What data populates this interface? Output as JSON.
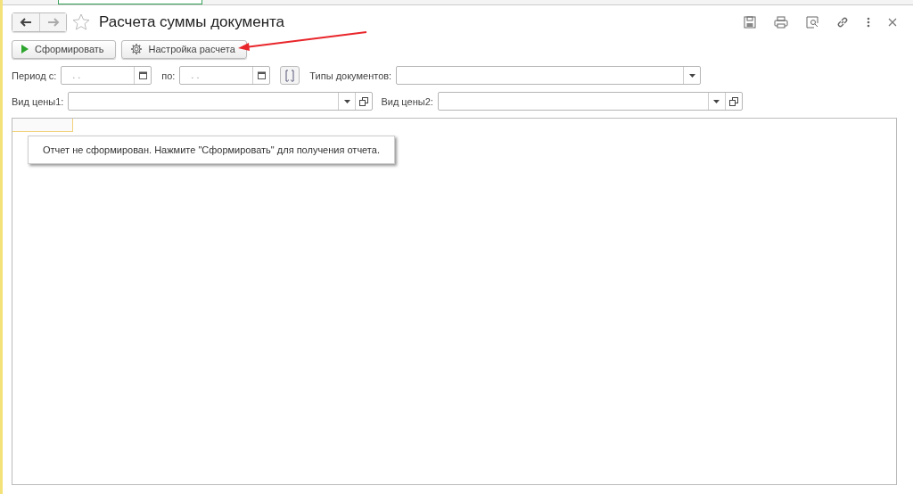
{
  "window": {
    "title": "Расчета суммы документа"
  },
  "toolbar": {
    "buttons": [
      {
        "kind": "run",
        "label": "Сформировать"
      },
      {
        "kind": "settings",
        "label": "Настройка расчета"
      }
    ]
  },
  "filters": {
    "period_from": {
      "label": "Период с:",
      "value": ". ."
    },
    "period_to": {
      "label": "по:",
      "value": ". ."
    },
    "doc_types": {
      "label": "Типы документов:"
    },
    "price_type_1": {
      "label": "Вид цены1:"
    },
    "price_type_2": {
      "label": "Вид цены2:"
    }
  },
  "report": {
    "message": "Отчет не сформирован. Нажмите \"Сформировать\" для получения отчета."
  }
}
